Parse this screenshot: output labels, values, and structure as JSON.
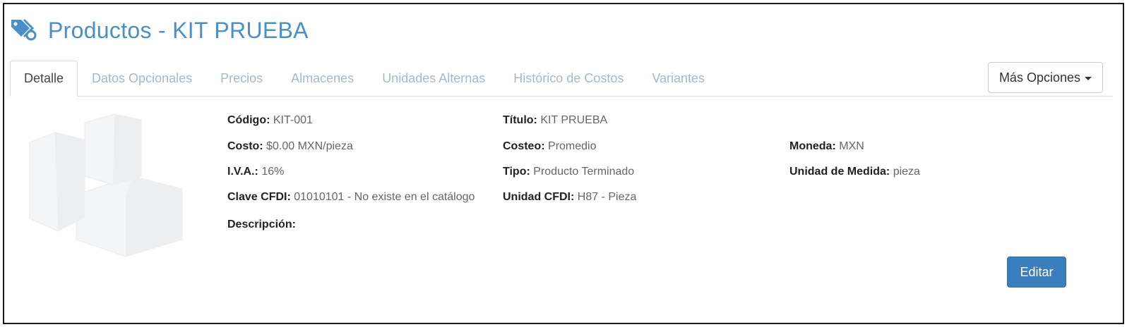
{
  "header": {
    "title": "Productos - KIT PRUEBA",
    "icon": "tags-icon"
  },
  "tabs": [
    {
      "label": "Detalle",
      "active": true
    },
    {
      "label": "Datos Opcionales"
    },
    {
      "label": "Precios"
    },
    {
      "label": "Almacenes"
    },
    {
      "label": "Unidades Alternas"
    },
    {
      "label": "Histórico de Costos"
    },
    {
      "label": "Variantes"
    }
  ],
  "more_options": {
    "label": "Más Opciones"
  },
  "fields": {
    "codigo": {
      "label": "Código:",
      "value": "KIT-001"
    },
    "costo": {
      "label": "Costo:",
      "value": "$0.00 MXN/pieza"
    },
    "iva": {
      "label": "I.V.A.:",
      "value": "16%"
    },
    "clave_cfdi": {
      "label": "Clave CFDI:",
      "value": "01010101 - No existe en el catálogo"
    },
    "descripcion": {
      "label": "Descripción:",
      "value": ""
    },
    "titulo": {
      "label": "Título:",
      "value": "KIT PRUEBA"
    },
    "costeo": {
      "label": "Costeo:",
      "value": "Promedio"
    },
    "tipo": {
      "label": "Tipo:",
      "value": "Producto Terminado"
    },
    "unidad_cfdi": {
      "label": "Unidad CFDI:",
      "value": "H87 - Pieza"
    },
    "moneda": {
      "label": "Moneda:",
      "value": "MXN"
    },
    "unidad_medida": {
      "label": "Unidad de Medida:",
      "value": "pieza"
    }
  },
  "edit_button": {
    "label": "Editar"
  },
  "colors": {
    "accent": "#4a8fc6",
    "primary_button": "#3a7ebd",
    "tab_inactive": "#a9b8c6"
  }
}
